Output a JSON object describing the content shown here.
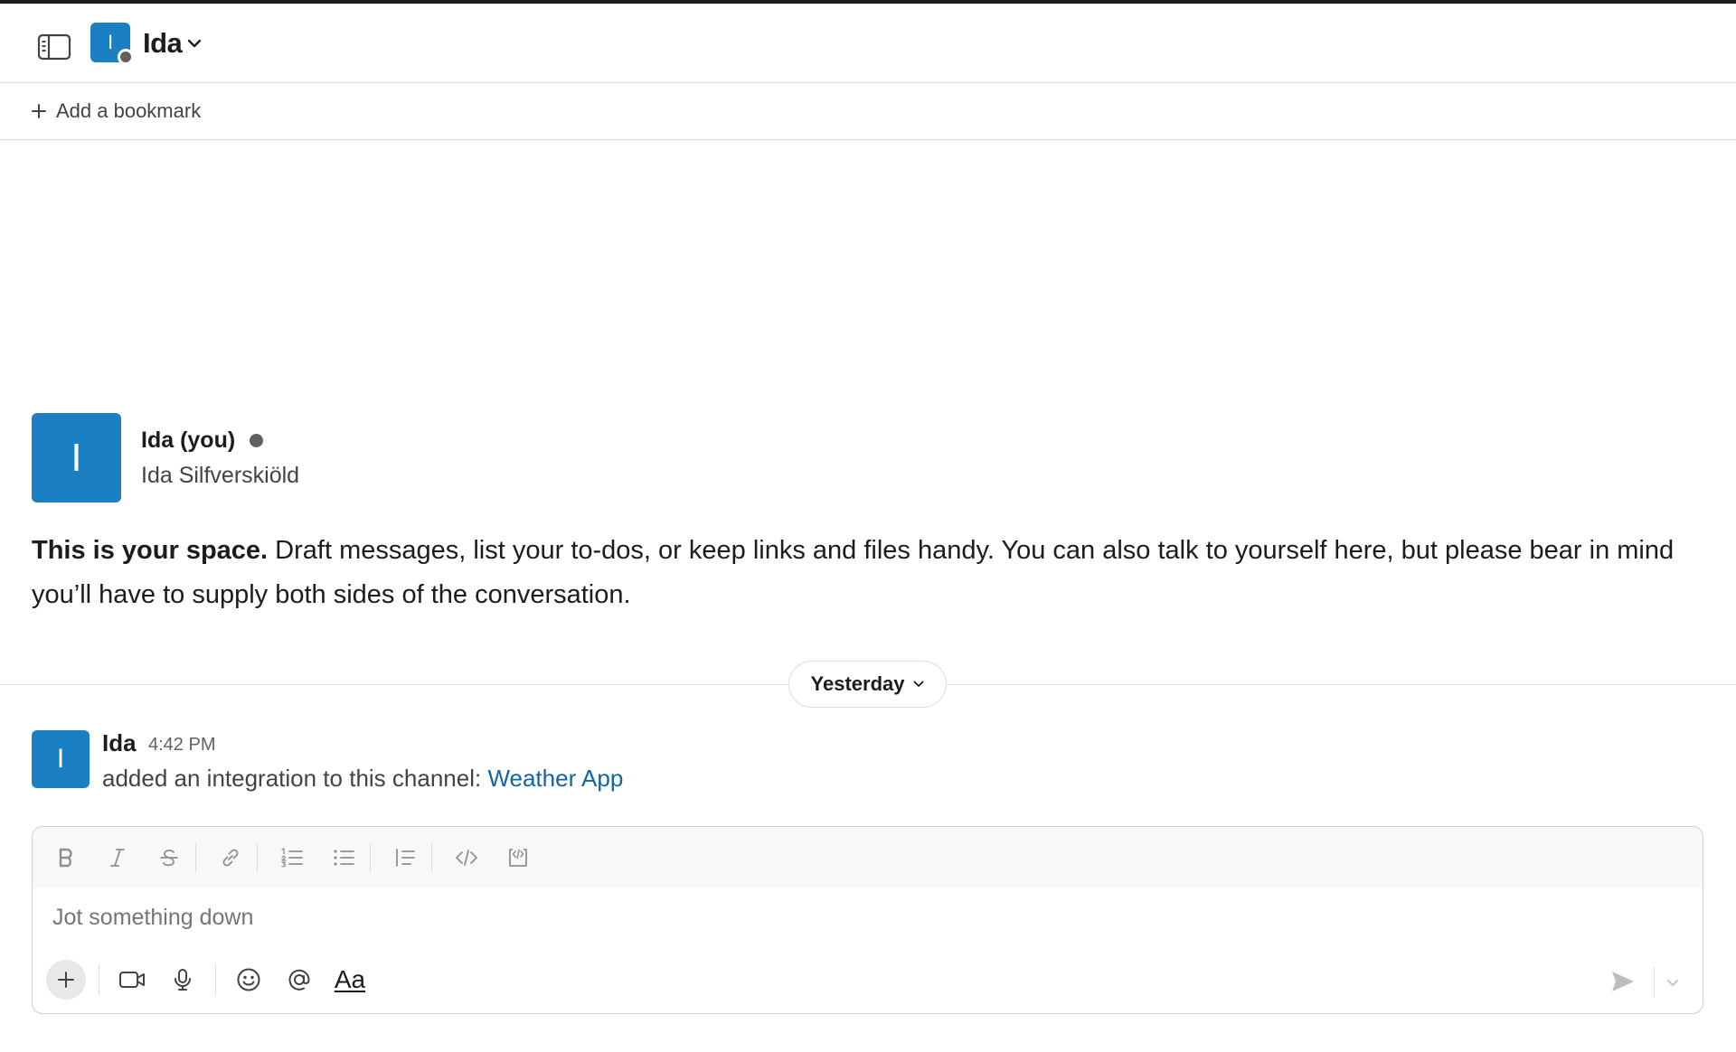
{
  "header": {
    "channel_name": "Ida",
    "channel_avatar_initial": "I"
  },
  "bookmarks": {
    "add_label": "Add a bookmark"
  },
  "intro": {
    "avatar_initial": "I",
    "display_name": "Ida (you)",
    "full_name": "Ida Silfverskiöld",
    "bold_text": "This is your space.",
    "text": " Draft messages, list your to-dos, or keep links and files handy. You can also talk to yourself here, but please bear in mind you’ll have to supply both sides of the conversation."
  },
  "date_divider": {
    "label": "Yesterday"
  },
  "messages": [
    {
      "avatar_initial": "I",
      "author": "Ida",
      "time": "4:42 PM",
      "text": "added an integration to this channel: ",
      "link": "Weather App"
    }
  ],
  "composer": {
    "placeholder": "Jot something down",
    "text_format_label": "Aa"
  },
  "colors": {
    "accent": "#1a7fc3",
    "link": "#1264a3",
    "status_away": "#616061"
  }
}
